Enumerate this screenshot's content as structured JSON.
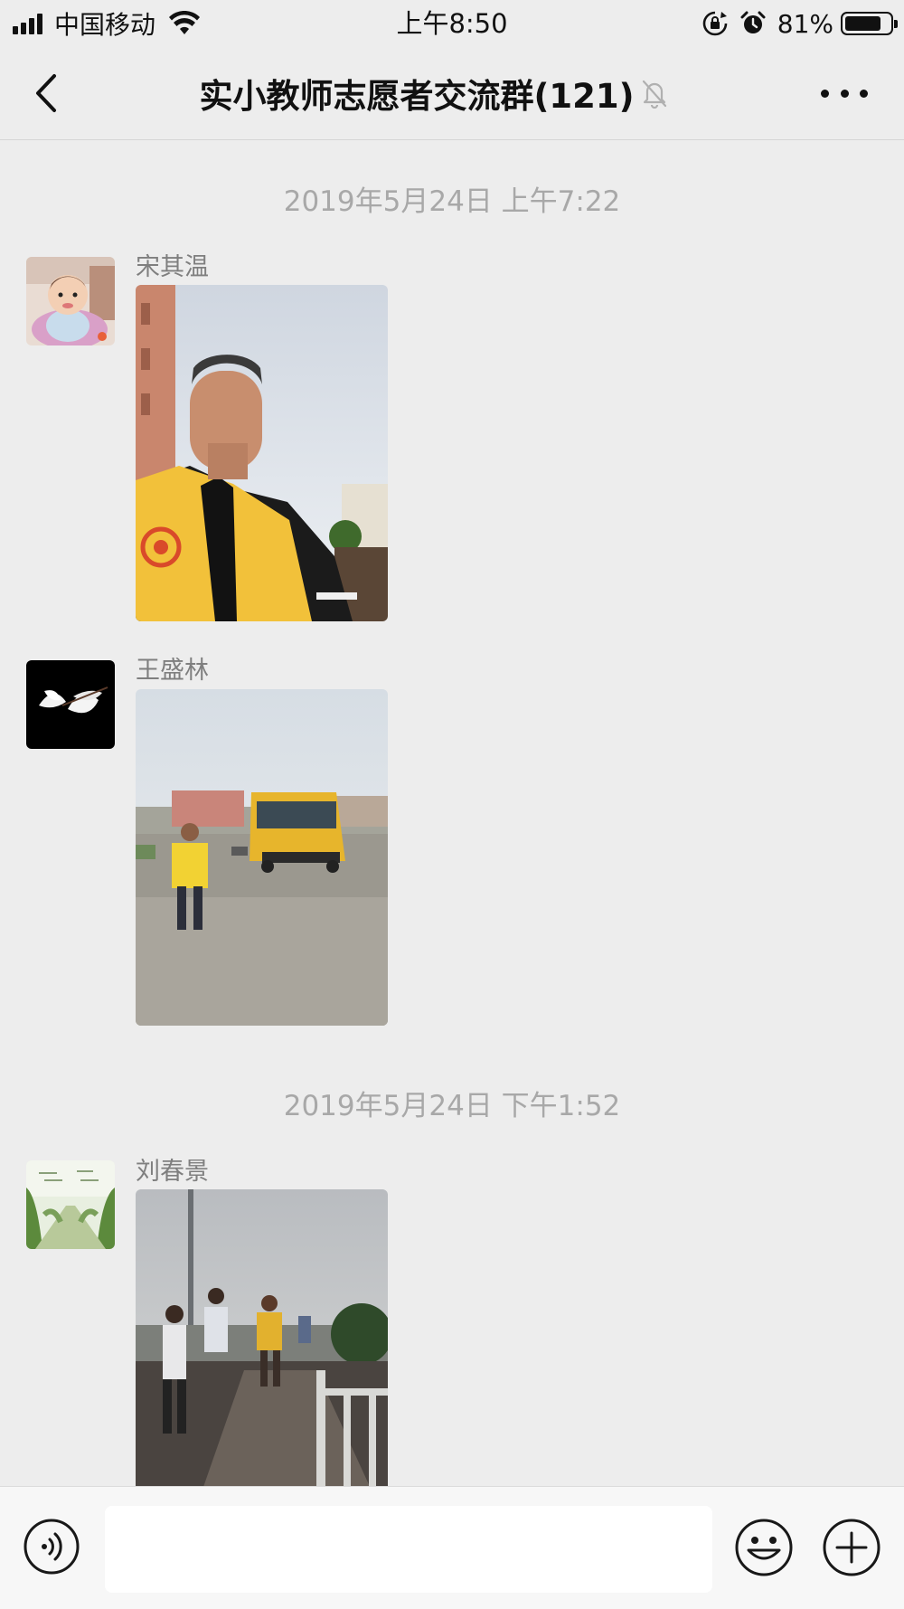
{
  "status_bar": {
    "carrier": "中国移动",
    "time": "上午8:50",
    "battery_percent": "81%",
    "battery_level": 0.81
  },
  "nav": {
    "title": "实小教师志愿者交流群(121)",
    "back_icon": "chevron-left-icon",
    "mute_icon": "bell-off-icon",
    "more_icon": "more-dots-icon"
  },
  "messages": [
    {
      "timestamp": "2019年5月24日 上午7:22",
      "items": [
        {
          "sender": "宋其温",
          "avatar": "baby-photo",
          "content": "man in yellow volunteer vest selfie photo"
        },
        {
          "sender": "王盛林",
          "avatar": "white-magnolia-photo",
          "content": "man in yellow vest beside school bus photo"
        }
      ]
    },
    {
      "timestamp": "2019年5月24日 下午1:52",
      "items": [
        {
          "sender": "刘春景",
          "avatar": "tree-lined-road-photo",
          "content": "runners on road photo"
        }
      ]
    }
  ],
  "input_bar": {
    "voice_icon": "voice-icon",
    "emoji_icon": "emoji-icon",
    "plus_icon": "plus-circle-icon",
    "placeholder": ""
  },
  "colors": {
    "background": "#ededed",
    "timestamp": "#a8a8a8",
    "sender_name": "#7f7f7f",
    "input_bar": "#f7f7f7",
    "vest_yellow": "#f2c13a"
  }
}
